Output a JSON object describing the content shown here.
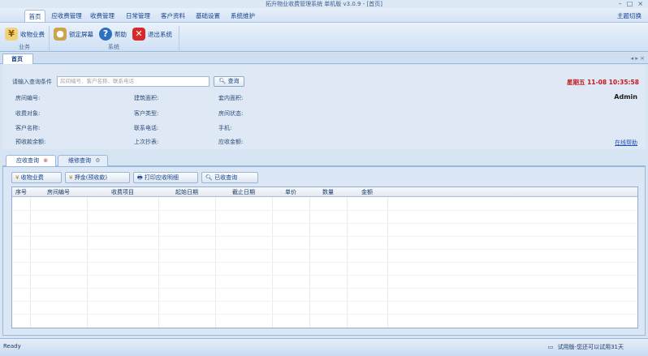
{
  "window": {
    "title": "拓升物业收费管理系统 单机版 v3.0.9 - [首页]",
    "controls": [
      "–",
      "□",
      "×"
    ]
  },
  "menu": {
    "items": [
      "首页",
      "应收费管理",
      "收费管理",
      "日常管理",
      "客户资料",
      "基础设置",
      "系统维护"
    ],
    "theme_switch": "主题切换"
  },
  "ribbon": {
    "buttons": {
      "collect": "收物业费",
      "lock": "锁定屏幕",
      "help": "帮助",
      "exit": "退出系统"
    },
    "groups": {
      "business": "业务",
      "system": "系统"
    }
  },
  "doc_tab": {
    "label": "首页",
    "nav": "◂ ▸ ×"
  },
  "search": {
    "label": "请输入查询条件",
    "placeholder": "房间编号、客户名称、联系电话",
    "query_button": "查询",
    "datetime": "星期五 11-08 10:35:58",
    "user": "Admin",
    "online_help": "在线帮助",
    "fields": [
      "房间编号:",
      "建筑面积:",
      "套内面积:",
      "收费对象:",
      "客户类型:",
      "房间状态:",
      "客户名称:",
      "联系电话:",
      "手机:",
      "预收款余额:",
      "上次抄表:",
      "应收金额:"
    ]
  },
  "bottom_tabs": [
    "应收查询",
    "维修查询"
  ],
  "toolbar": {
    "collect": "收物业费",
    "deposit": "押金(预收款)",
    "print": "打印应收明细",
    "received": "已收查询"
  },
  "table": {
    "columns": [
      "序号",
      "房间编号",
      "收费项目",
      "起始日期",
      "截止日期",
      "单价",
      "数量",
      "金额"
    ]
  },
  "status": {
    "ready": "Ready",
    "trial": "试用版-您还可以试用31天"
  },
  "colors": {
    "accent": "#15428b",
    "date": "#c4171b",
    "background": "#d7e4f2"
  }
}
